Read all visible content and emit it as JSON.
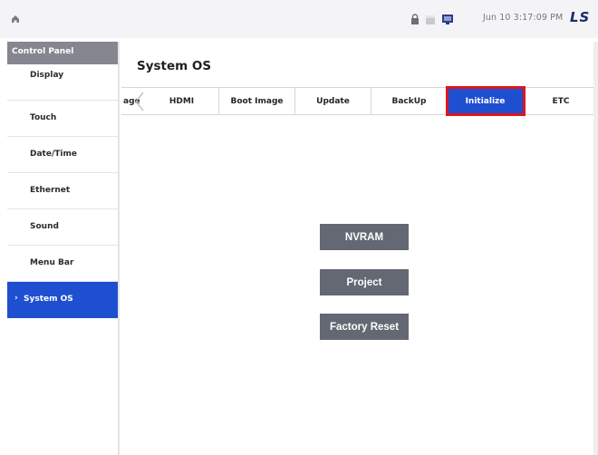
{
  "topbar": {
    "home_icon": "home-icon",
    "status_icons": [
      "lock-icon",
      "battery-icon",
      "monitor-icon"
    ],
    "datetime": "Jun 10 3:17:09 PM",
    "logo": "LS"
  },
  "sidebar": {
    "header": "Control Panel",
    "items": [
      {
        "label": "Display"
      },
      {
        "label": "Touch"
      },
      {
        "label": "Date/Time"
      },
      {
        "label": "Ethernet"
      },
      {
        "label": "Sound"
      },
      {
        "label": "Menu Bar"
      },
      {
        "label": "System OS",
        "active": true
      }
    ],
    "active_marker": "›"
  },
  "main": {
    "title": "System OS",
    "tabs": [
      {
        "label": "age"
      },
      {
        "label": "HDMI"
      },
      {
        "label": "Boot Image"
      },
      {
        "label": "Update"
      },
      {
        "label": "BackUp"
      },
      {
        "label": "Initialize",
        "selected": true
      },
      {
        "label": "ETC"
      }
    ],
    "buttons": [
      {
        "label": "NVRAM"
      },
      {
        "label": "Project"
      },
      {
        "label": "Factory Reset"
      }
    ]
  },
  "colors": {
    "accent": "#1e4fd0",
    "highlight_border": "#e0141c",
    "button_bg": "#646872",
    "sidebar_header_bg": "#868690"
  }
}
